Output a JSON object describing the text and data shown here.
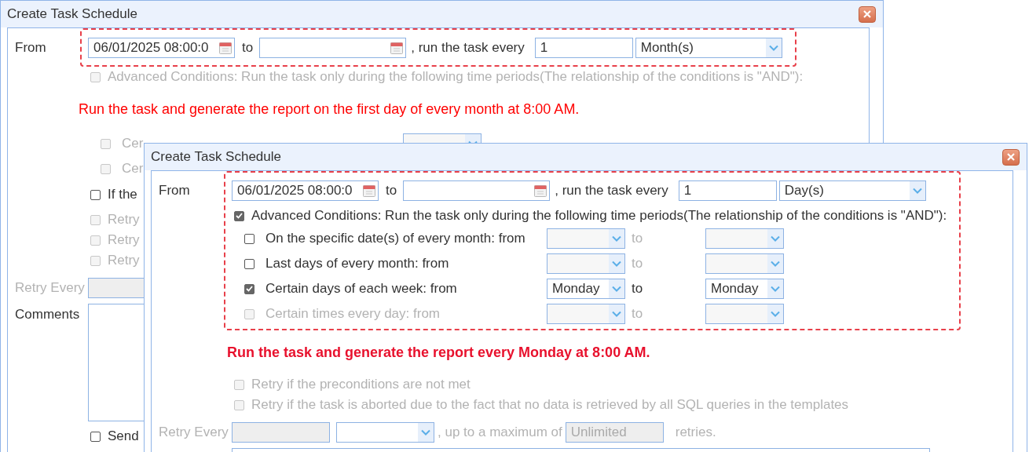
{
  "windows": [
    {
      "title": "Create Task Schedule",
      "schedule": {
        "from_label": "From",
        "start": "06/01/2025 08:00:0",
        "to_label": "to",
        "every_label": ", run the task every",
        "interval": "1",
        "unit": "Month(s)",
        "highlighted": true
      },
      "items": [
        {
          "kind": "check",
          "label": "Advanced Conditions: Run the task only during the following time periods(The relationship of the conditions is \"AND\"):",
          "checked": false,
          "disabled": true,
          "highlighted": false
        },
        {
          "kind": "note",
          "text": "Run the task and generate the report on the first day of every month at 8:00 AM.",
          "bold": false
        },
        {
          "kind": "condition",
          "label": "Cer",
          "checked": false,
          "disabled": true,
          "selects": true,
          "highlighted": false
        },
        {
          "kind": "condition",
          "label": "Cer",
          "checked": false,
          "disabled": true,
          "highlighted": false
        },
        {
          "kind": "check",
          "label": "If the",
          "checked": false,
          "disabled": false,
          "highlighted": false
        },
        {
          "kind": "check",
          "label": "Retry",
          "checked": false,
          "disabled": true,
          "highlighted": false
        },
        {
          "kind": "check",
          "label": "Retry",
          "checked": false,
          "disabled": true,
          "highlighted": false
        },
        {
          "kind": "check",
          "label": "Retry",
          "checked": false,
          "disabled": true,
          "highlighted": false
        },
        {
          "kind": "retry_every",
          "label": "Retry Every",
          "disabled": true
        },
        {
          "kind": "comments",
          "label": "Comments"
        },
        {
          "kind": "check",
          "label": "Send",
          "checked": false,
          "disabled": false,
          "highlighted": false
        }
      ]
    },
    {
      "title": "Create Task Schedule",
      "schedule": {
        "from_label": "From",
        "start": "06/01/2025 08:00:0",
        "to_label": "to",
        "every_label": ", run the task every",
        "interval": "1",
        "unit": "Day(s)",
        "highlighted": true
      },
      "items": [
        {
          "kind": "check",
          "label": "Advanced Conditions: Run the task only during the following time periods(The relationship of the conditions is \"AND\"):",
          "checked": true,
          "disabled": false,
          "highlighted": true
        },
        {
          "kind": "condition",
          "label": "On the specific date(s) of every month: from",
          "checked": false,
          "disabled": false,
          "selects": true,
          "to_label": "to",
          "highlighted": true
        },
        {
          "kind": "condition",
          "label": "Last days of every month: from",
          "checked": false,
          "disabled": false,
          "selects": true,
          "to_label": "to",
          "highlighted": true
        },
        {
          "kind": "condition",
          "label": "Certain days of each week: from",
          "checked": true,
          "disabled": false,
          "selects": true,
          "to_label": "to",
          "from_value": "Monday",
          "to_value": "Monday",
          "highlighted": true
        },
        {
          "kind": "condition",
          "label": "Certain times every day: from",
          "checked": false,
          "disabled": true,
          "selects": true,
          "to_label": "to",
          "highlighted": true
        },
        {
          "kind": "note",
          "text": "Run the task and generate the report every Monday at 8:00 AM.",
          "bold": true
        },
        {
          "kind": "check",
          "label": "Retry if the preconditions are not met",
          "checked": false,
          "disabled": true,
          "highlighted": false
        },
        {
          "kind": "check",
          "label": "Retry if the task is aborted due to the fact that no data is retrieved by all SQL queries in the templates",
          "checked": false,
          "disabled": true,
          "highlighted": false
        },
        {
          "kind": "retry_every",
          "label": "Retry Every",
          "disabled": true,
          "dropdown": true,
          "max_label": ", up to a maximum of",
          "max": "Unlimited",
          "end": "retries."
        },
        {
          "kind": "comments"
        }
      ]
    }
  ]
}
